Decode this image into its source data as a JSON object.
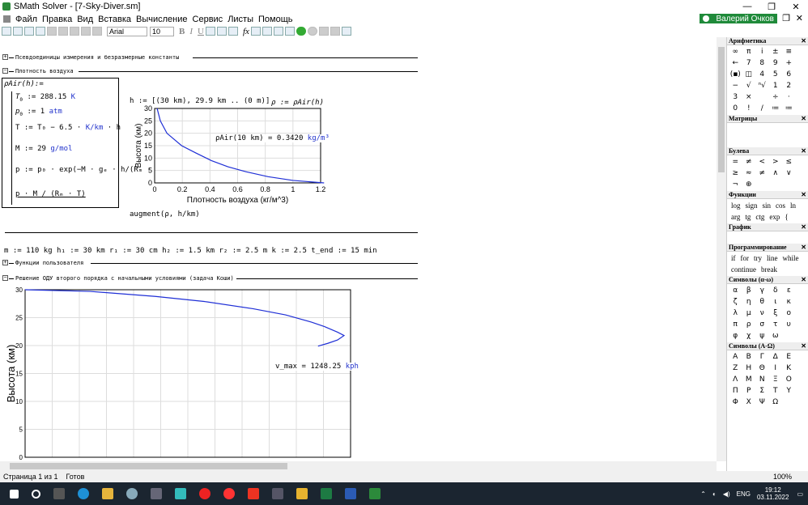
{
  "window": {
    "title": "SMath Solver - [7-Sky-Diver.sm]",
    "min": "—",
    "max": "❐",
    "close": "✕"
  },
  "menu": [
    "Файл",
    "Правка",
    "Вид",
    "Вставка",
    "Вычисление",
    "Сервис",
    "Листы",
    "Помощь"
  ],
  "user": "Валерий Очков",
  "toolbar": {
    "font": "Arial",
    "size": "10",
    "b": "B",
    "i": "I",
    "u": "U",
    "fx": "fx"
  },
  "sections": {
    "units": "Псевдоединицы измерения и безразмерные константы",
    "density": "Плотность воздуха",
    "userfunc": "Функции пользователя",
    "ode": "Решение ОДУ второго порядка с начальными условиями (задача Коши)"
  },
  "density_def": {
    "head": "ρAir(h):=",
    "l1a": "T",
    "l1b": "0",
    "l1c": " := 288.15",
    "l1u": "K",
    "l2a": "p",
    "l2b": "0",
    "l2c": " := 1",
    "l2u": "atm",
    "l3": "T := T₀ − 6.5 · ",
    "l3u": "K/km",
    "l3h": " · h",
    "l4": "M := 29 ",
    "l4u": "g/mol",
    "l5": "p := p₀ · exp(−M · gₑ · h/(Rₘ · T))",
    "l6": "p · M / (Rₘ · T)"
  },
  "hrange": "h := [(30 km), 29.9 km .. (0 m)]",
  "rhovec": "ρ := ρAir(h)",
  "rho10": "ρAir(10 km) = 0.3420",
  "rho10u": "kg/m³",
  "augment": "augment(ρ, h/km)",
  "params": "m := 110 kg   h₁ := 30 km   r₁ := 30 cm   h₂ := 1.5 km   r₂ := 2.5 m   k := 2.5   t_end := 15 min",
  "vmax": "v_max = 1248.25",
  "vmax_u": "kph",
  "chart_data": [
    {
      "type": "line",
      "xlabel": "Плотность воздуха (кг/м^3)",
      "ylabel": "Высота (км)",
      "xlim": [
        0,
        1.2
      ],
      "ylim": [
        0,
        30
      ],
      "x_ticks": [
        "0",
        "0.2",
        "0.4",
        "0.6",
        "0.8",
        "1",
        "1.2"
      ],
      "y_ticks": [
        "0",
        "5",
        "10",
        "15",
        "20",
        "25",
        "30"
      ],
      "series": [
        {
          "x": [
            0.018,
            0.041,
            0.089,
            0.195,
            0.3,
            0.41,
            0.53,
            0.66,
            0.82,
            1.0,
            1.225
          ],
          "y": [
            30,
            25,
            20,
            15,
            12,
            9,
            6.5,
            4.5,
            2.5,
            1,
            0
          ]
        }
      ],
      "grid": true
    },
    {
      "type": "line",
      "xlabel": "",
      "ylabel": "Высота (км)",
      "ylim": [
        0,
        30
      ],
      "y_ticks": [
        "0",
        "5",
        "10",
        "15",
        "20",
        "25",
        "30"
      ],
      "series": [
        {
          "x": [
            0,
            0.2,
            0.4,
            0.55,
            0.7,
            0.8,
            0.88,
            0.92,
            0.96,
            0.98,
            0.96,
            0.93,
            0.9
          ],
          "y": [
            30,
            29.7,
            28.8,
            27.9,
            26.6,
            25.5,
            24.2,
            23.4,
            22.4,
            21.8,
            21.0,
            20.4,
            19.9
          ]
        }
      ],
      "grid": true
    }
  ],
  "panel": {
    "arith": "Арифметика",
    "arith_keys": [
      "∞",
      "π",
      "i",
      "±",
      "≡",
      "←",
      "7",
      "8",
      "9",
      "+",
      "(▪)",
      "◫",
      "4",
      "5",
      "6",
      "−",
      "√",
      "ⁿ√",
      "1",
      "2",
      "3",
      "×",
      "",
      "÷",
      "·",
      "0",
      "!",
      "/",
      "≔",
      "≔"
    ],
    "matrix": "Матрицы",
    "boolean": "Булева",
    "bool_keys": [
      "=",
      "≠",
      "<",
      ">",
      "≤",
      "≥",
      "≈",
      "≠",
      "∧",
      "∨",
      "¬",
      "⊕"
    ],
    "functions": "Функции",
    "func_keys": [
      "log",
      "sign",
      "sin",
      "cos",
      "ln",
      "arg",
      "tg",
      "ctg",
      "exp",
      "{"
    ],
    "graph": "График",
    "program": "Программирование",
    "prog_keys": [
      "if",
      "for",
      "try",
      "line",
      "while",
      "continue",
      "break"
    ],
    "greek_lower": "Символы (α-ω)",
    "gl_keys": [
      "α",
      "β",
      "γ",
      "δ",
      "ε",
      "ζ",
      "η",
      "θ",
      "ι",
      "κ",
      "λ",
      "μ",
      "ν",
      "ξ",
      "ο",
      "π",
      "ρ",
      "σ",
      "τ",
      "υ",
      "φ",
      "χ",
      "ψ",
      "ω"
    ],
    "greek_upper": "Символы (Α-Ω)",
    "gu_keys": [
      "Α",
      "Β",
      "Γ",
      "Δ",
      "Ε",
      "Ζ",
      "Η",
      "Θ",
      "Ι",
      "Κ",
      "Λ",
      "Μ",
      "Ν",
      "Ξ",
      "Ο",
      "Π",
      "Ρ",
      "Σ",
      "Τ",
      "Υ",
      "Φ",
      "Χ",
      "Ψ",
      "Ω"
    ]
  },
  "status": {
    "page": "Страница 1 из 1",
    "state": "Готов",
    "zoom": "100%"
  },
  "tray": {
    "lang": "ENG",
    "time": "19:12",
    "date": "03.11.2022"
  }
}
